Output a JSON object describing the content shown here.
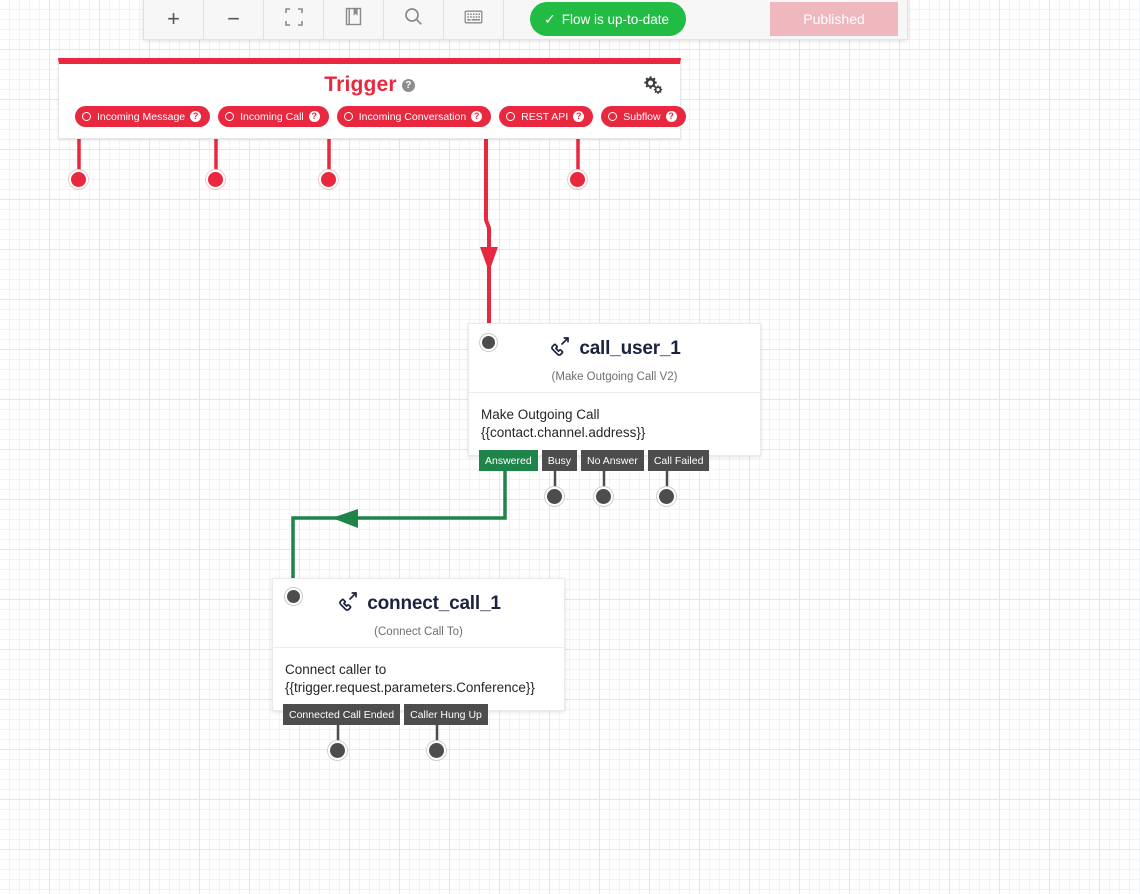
{
  "toolbar": {
    "buttons": [
      {
        "name": "zoom-in",
        "glyph": "+",
        "label": "Zoom In"
      },
      {
        "name": "zoom-out",
        "glyph": "−",
        "label": "Zoom Out"
      },
      {
        "name": "fit-to-screen",
        "glyph": "crop-icon",
        "label": "Fit to Screen"
      },
      {
        "name": "library",
        "glyph": "book-icon",
        "label": "Library"
      },
      {
        "name": "search",
        "glyph": "search-icon",
        "label": "Search"
      },
      {
        "name": "keyboard",
        "glyph": "keyboard-icon",
        "label": "Keyboard Shortcuts"
      }
    ],
    "flow_status": "Flow is up-to-date",
    "flow_status_check": "✓",
    "flow_status_color": "#22bb44",
    "published_label": "Published",
    "published_color": "#efb8bf"
  },
  "trigger": {
    "title": "Trigger",
    "help": "?",
    "gear": "gear-icon",
    "accent_color": "#e8283f",
    "pills": [
      {
        "label": "Incoming Message",
        "help": "?"
      },
      {
        "label": "Incoming Call",
        "help": "?"
      },
      {
        "label": "Incoming Conversation",
        "help": "?"
      },
      {
        "label": "REST API",
        "help": "?"
      },
      {
        "label": "Subflow",
        "help": "?"
      }
    ]
  },
  "nodes": [
    {
      "id": "call_user_1",
      "title": "call_user_1",
      "icon": "phone-icon",
      "subtitle": "(Make Outgoing Call V2)",
      "body_line1": "Make Outgoing Call",
      "body_line2": "{{contact.channel.address}}",
      "outputs": [
        {
          "label": "Answered",
          "state": "connected"
        },
        {
          "label": "Busy",
          "state": "open"
        },
        {
          "label": "No Answer",
          "state": "open"
        },
        {
          "label": "Call Failed",
          "state": "open"
        }
      ]
    },
    {
      "id": "connect_call_1",
      "title": "connect_call_1",
      "icon": "phone-icon",
      "subtitle": "(Connect Call To)",
      "body_line1": "Connect caller to",
      "body_line2": "{{trigger.request.parameters.Conference}}",
      "outputs": [
        {
          "label": "Connected Call Ended",
          "state": "open"
        },
        {
          "label": "Caller Hung Up",
          "state": "open"
        }
      ]
    }
  ],
  "connections": {
    "rest_api_to_call_user_1_color": "#e8283f",
    "answered_to_connect_call_1_color": "#1e8449"
  }
}
